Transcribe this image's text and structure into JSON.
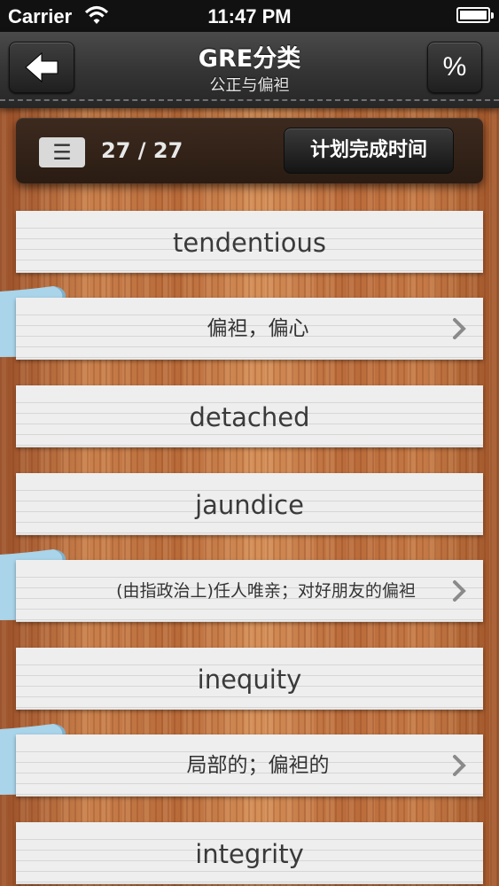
{
  "status_bar": {
    "carrier": "Carrier",
    "time": "11:47 PM"
  },
  "nav": {
    "title": "GRE分类",
    "subtitle": "公正与偏袒",
    "back_icon": "back-arrow-icon",
    "percent_label": "%"
  },
  "progress": {
    "icon_glyph": "☰",
    "count": "27 / 27",
    "plan_button": "计划完成时间"
  },
  "cards": [
    {
      "type": "word",
      "text": "tendentious"
    },
    {
      "type": "meaning",
      "text": "偏袒，偏心"
    },
    {
      "type": "word",
      "text": "detached"
    },
    {
      "type": "word",
      "text": "jaundice"
    },
    {
      "type": "meaning",
      "text": "(由指政治上)任人唯亲；对好朋友的偏袒"
    },
    {
      "type": "word",
      "text": "inequity"
    },
    {
      "type": "meaning",
      "text": "局部的；偏袒的"
    },
    {
      "type": "word",
      "text": "integrity"
    }
  ],
  "colors": {
    "ribbon": "#a9d4ea",
    "card": "#eeeeee",
    "panel": "#2e1f15"
  }
}
